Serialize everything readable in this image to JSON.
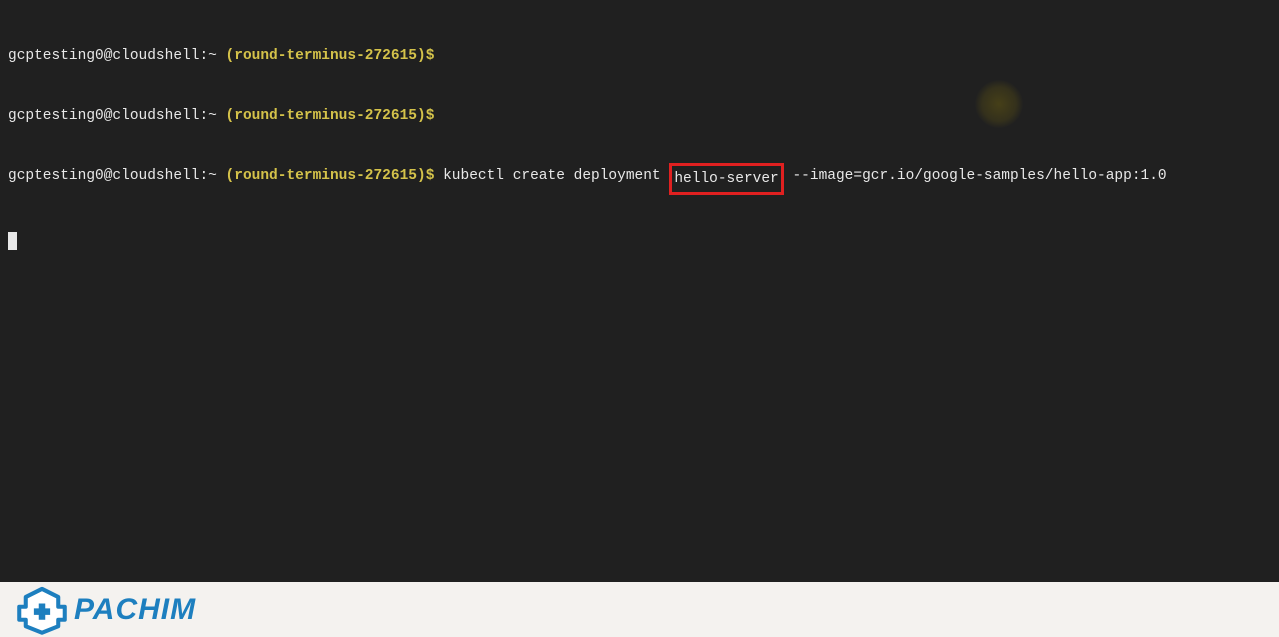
{
  "terminal": {
    "lines": [
      {
        "user": "gcptesting0@cloudshell",
        "sep1": ":",
        "path": "~",
        "sp1": " ",
        "lparen": "(",
        "project": "round-terminus-272615",
        "rparen": ")",
        "dollar": "$",
        "cmd_pre": "",
        "highlighted": "",
        "cmd_post": ""
      },
      {
        "user": "gcptesting0@cloudshell",
        "sep1": ":",
        "path": "~",
        "sp1": " ",
        "lparen": "(",
        "project": "round-terminus-272615",
        "rparen": ")",
        "dollar": "$",
        "cmd_pre": "",
        "highlighted": "",
        "cmd_post": ""
      },
      {
        "user": "gcptesting0@cloudshell",
        "sep1": ":",
        "path": "~",
        "sp1": " ",
        "lparen": "(",
        "project": "round-terminus-272615",
        "rparen": ")",
        "dollar": "$",
        "cmd_pre": " kubectl create deployment ",
        "highlighted": "hello-server",
        "cmd_post": " --image=gcr.io/google-samples/hello-app:1.0"
      }
    ]
  },
  "branding": {
    "text": "PACHIM"
  },
  "colors": {
    "bg": "#202020",
    "text": "#e8e8e8",
    "accent_yellow": "#d4c24a",
    "highlight_border": "#e02020",
    "brand_blue": "#1d7fbf"
  }
}
